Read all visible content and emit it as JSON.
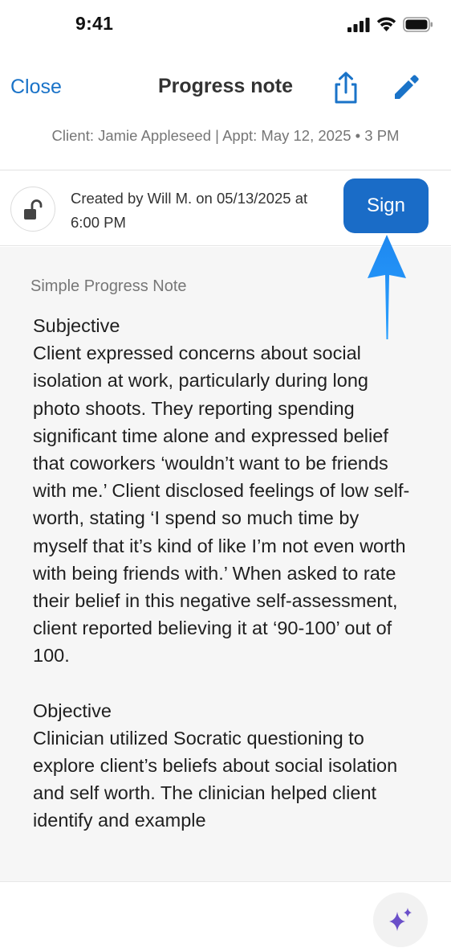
{
  "status_bar": {
    "time": "9:41",
    "icons": [
      "cellular-signal-icon",
      "wifi-icon",
      "battery-icon"
    ]
  },
  "nav": {
    "close_label": "Close",
    "title": "Progress note",
    "share_icon": "share-icon",
    "edit_icon": "pencil-icon"
  },
  "client_line": "Client: Jamie Appleseed | Appt: May 12, 2025 • 3 PM",
  "sign_row": {
    "lock_icon": "unlocked-padlock-icon",
    "created_text": "Created by Will M. on 05/13/2025 at 6:00 PM",
    "sign_label": "Sign"
  },
  "note": {
    "template_name": "Simple Progress Note",
    "sections": [
      {
        "heading": "Subjective",
        "text": "Client expressed concerns about social isolation at work, particularly during long photo shoots. They reporting spending significant time alone and expressed belief that coworkers ‘wouldn’t want to be friends with me.’ Client disclosed feelings of low self-worth, stating ‘I spend so much time by myself that it’s kind of like I’m not even worth with being friends with.’ When asked to rate their belief in this negative self-assessment, client reported believing it at ‘90-100’ out of 100."
      },
      {
        "heading": "Objective",
        "text": "Clinician utilized Socratic questioning to explore client’s beliefs about social isolation and self worth. The clinician helped client identify and example"
      }
    ]
  },
  "bottom_bar": {
    "ai_icon": "sparkles-icon"
  },
  "colors": {
    "accent": "#1a73c8",
    "sign_button": "#1a6cc7",
    "arrow": "#2196f3",
    "sparkle": "#6a4fc9",
    "content_background": "#f6f6f6"
  }
}
